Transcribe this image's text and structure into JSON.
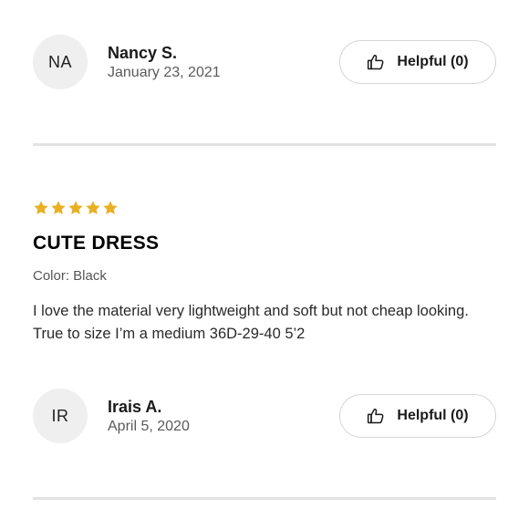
{
  "reviews_top": {
    "author": {
      "initials": "NA",
      "name": "Nancy S.",
      "date": "January 23, 2021"
    },
    "helpful_label": "Helpful (0)"
  },
  "review": {
    "rating": 5,
    "rating_max": 5,
    "star_color": "#E8B023",
    "title": "CUTE DRESS",
    "color_option": "Color: Black",
    "body": "I love the material very lightweight and soft but not cheap looking. True to size I’m a medium 36D-29-40 5’2",
    "author": {
      "initials": "IR",
      "name": "Irais A.",
      "date": "April 5, 2020"
    },
    "helpful_label": "Helpful (0)"
  },
  "icons": {
    "helpful": "thumbs-up-icon",
    "rating": "star-icon"
  }
}
